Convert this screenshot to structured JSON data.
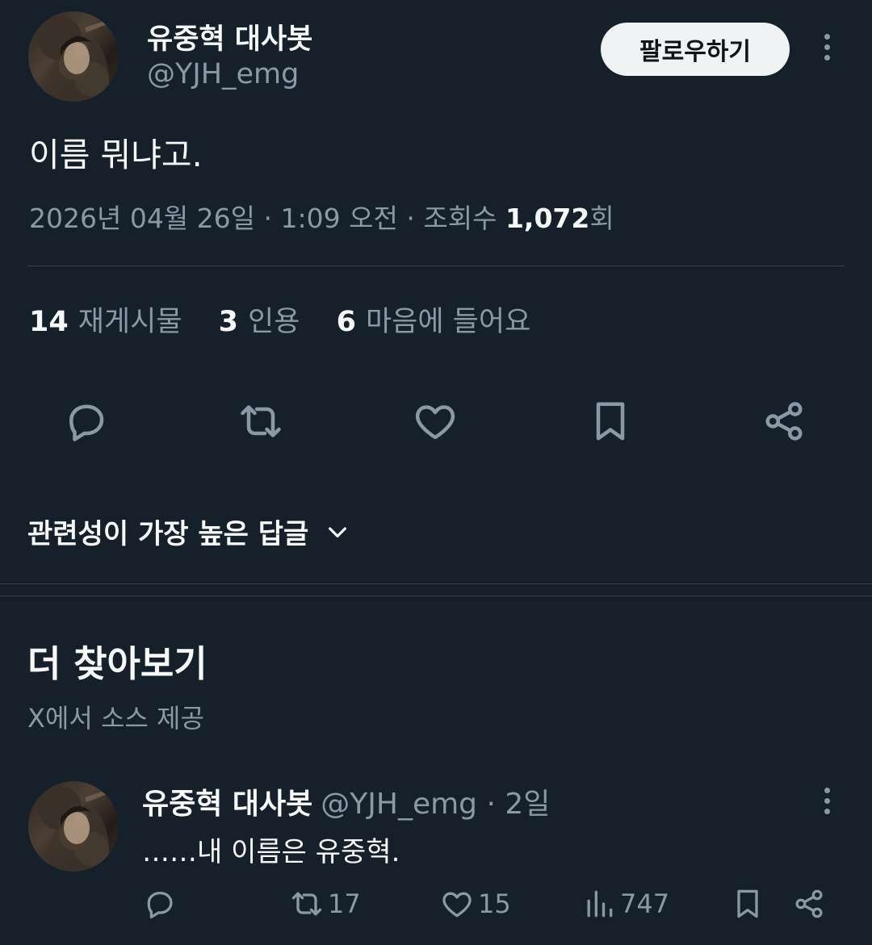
{
  "tweet": {
    "author_name": "유중혁 대사봇",
    "author_handle": "@YJH_emg",
    "follow_label": "팔로우하기",
    "text": "이름 뭐냐고.",
    "date": "2026년 04월 26일",
    "time": "1:09 오전",
    "views_label": "조회수",
    "views_count": "1,072",
    "views_suffix": "회",
    "separator": "·"
  },
  "stats": {
    "reposts_count": "14",
    "reposts_label": "재게시물",
    "quotes_count": "3",
    "quotes_label": "인용",
    "likes_count": "6",
    "likes_label": "마음에 들어요"
  },
  "actions": {
    "icons": [
      "reply-icon",
      "repost-icon",
      "like-icon",
      "bookmark-icon",
      "share-icon"
    ]
  },
  "replies_sort": {
    "label": "관련성이 가장 높은 답글"
  },
  "explore": {
    "title": "더 찾아보기",
    "source": "X에서 소스 제공"
  },
  "related_post": {
    "author_name": "유중혁 대사봇",
    "author_handle": "@YJH_emg",
    "age": "· 2일",
    "text": "……내 이름은 유중혁.",
    "replies_count": "",
    "reposts_count": "17",
    "likes_count": "15",
    "views_count": "747"
  },
  "colors": {
    "background": "#15202b",
    "text_primary": "#f7f9f9",
    "text_secondary": "#8b98a5",
    "divider": "#38444d",
    "follow_button_bg": "#eff3f4"
  }
}
